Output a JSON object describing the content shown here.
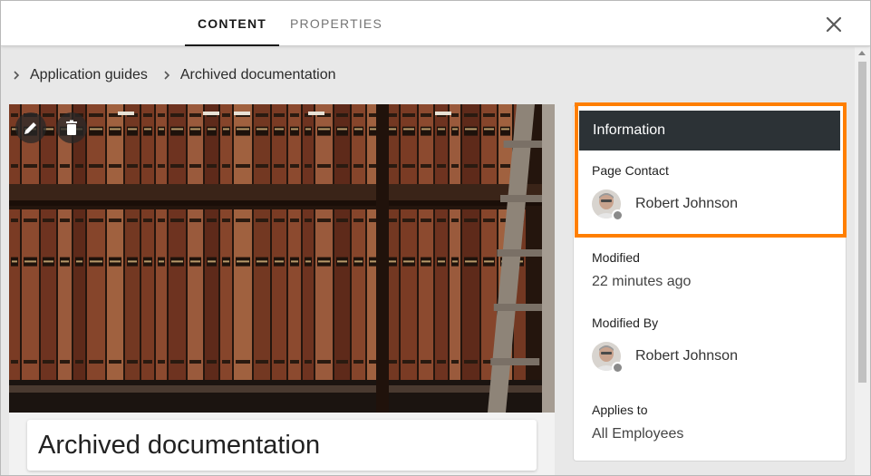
{
  "tabs": [
    {
      "label": "CONTENT",
      "active": true
    },
    {
      "label": "PROPERTIES",
      "active": false
    }
  ],
  "icons": {
    "close": "close-icon",
    "edit": "pencil-icon",
    "delete": "trash-icon",
    "breadcrumb_separator": "chevron-right-icon"
  },
  "breadcrumb": [
    "Application guides",
    "Archived documentation"
  ],
  "page": {
    "title": "Archived documentation",
    "hero_image": "library bookshelf photo"
  },
  "info": {
    "header": "Information",
    "page_contact_label": "Page Contact",
    "page_contact_name": "Robert Johnson",
    "modified_label": "Modified",
    "modified_value": "22 minutes ago",
    "modified_by_label": "Modified By",
    "modified_by_name": "Robert Johnson",
    "applies_to_label": "Applies to",
    "applies_to_value": "All Employees"
  },
  "colors": {
    "highlight": "#ff7f00",
    "info_header_bg": "#2c3236",
    "active_tab": "#1a1a1a",
    "inactive_tab": "#757575"
  }
}
